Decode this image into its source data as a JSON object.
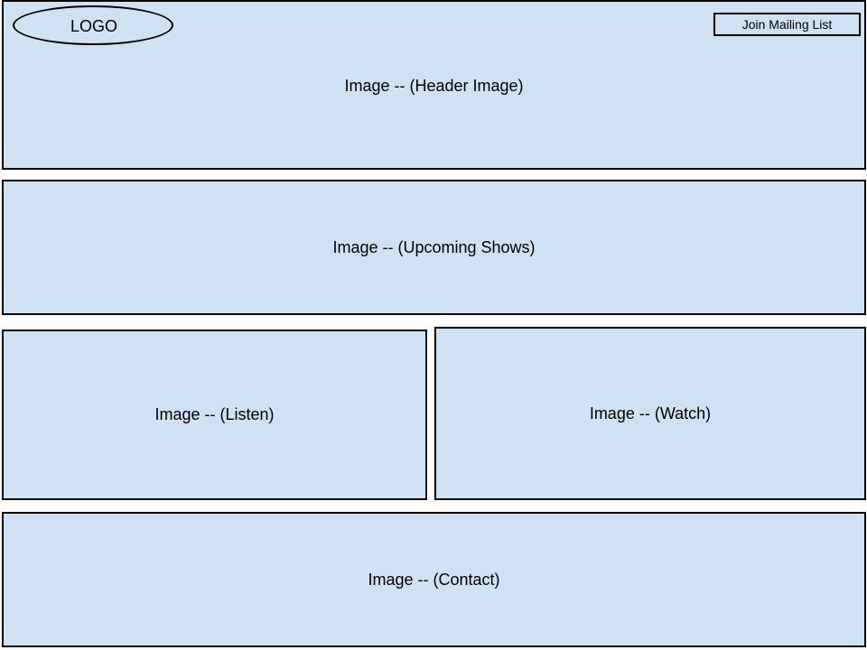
{
  "header": {
    "logo_text": "LOGO",
    "mailing_list_label": "Join Mailing List",
    "image_label": "Image -- (Header Image)"
  },
  "sections": {
    "upcoming_shows_label": "Image -- (Upcoming Shows)",
    "listen_label": "Image -- (Listen)",
    "watch_label": "Image -- (Watch)",
    "contact_label": "Image -- (Contact)"
  },
  "colors": {
    "block_fill": "#cfe2f3",
    "outline": "#000000"
  }
}
